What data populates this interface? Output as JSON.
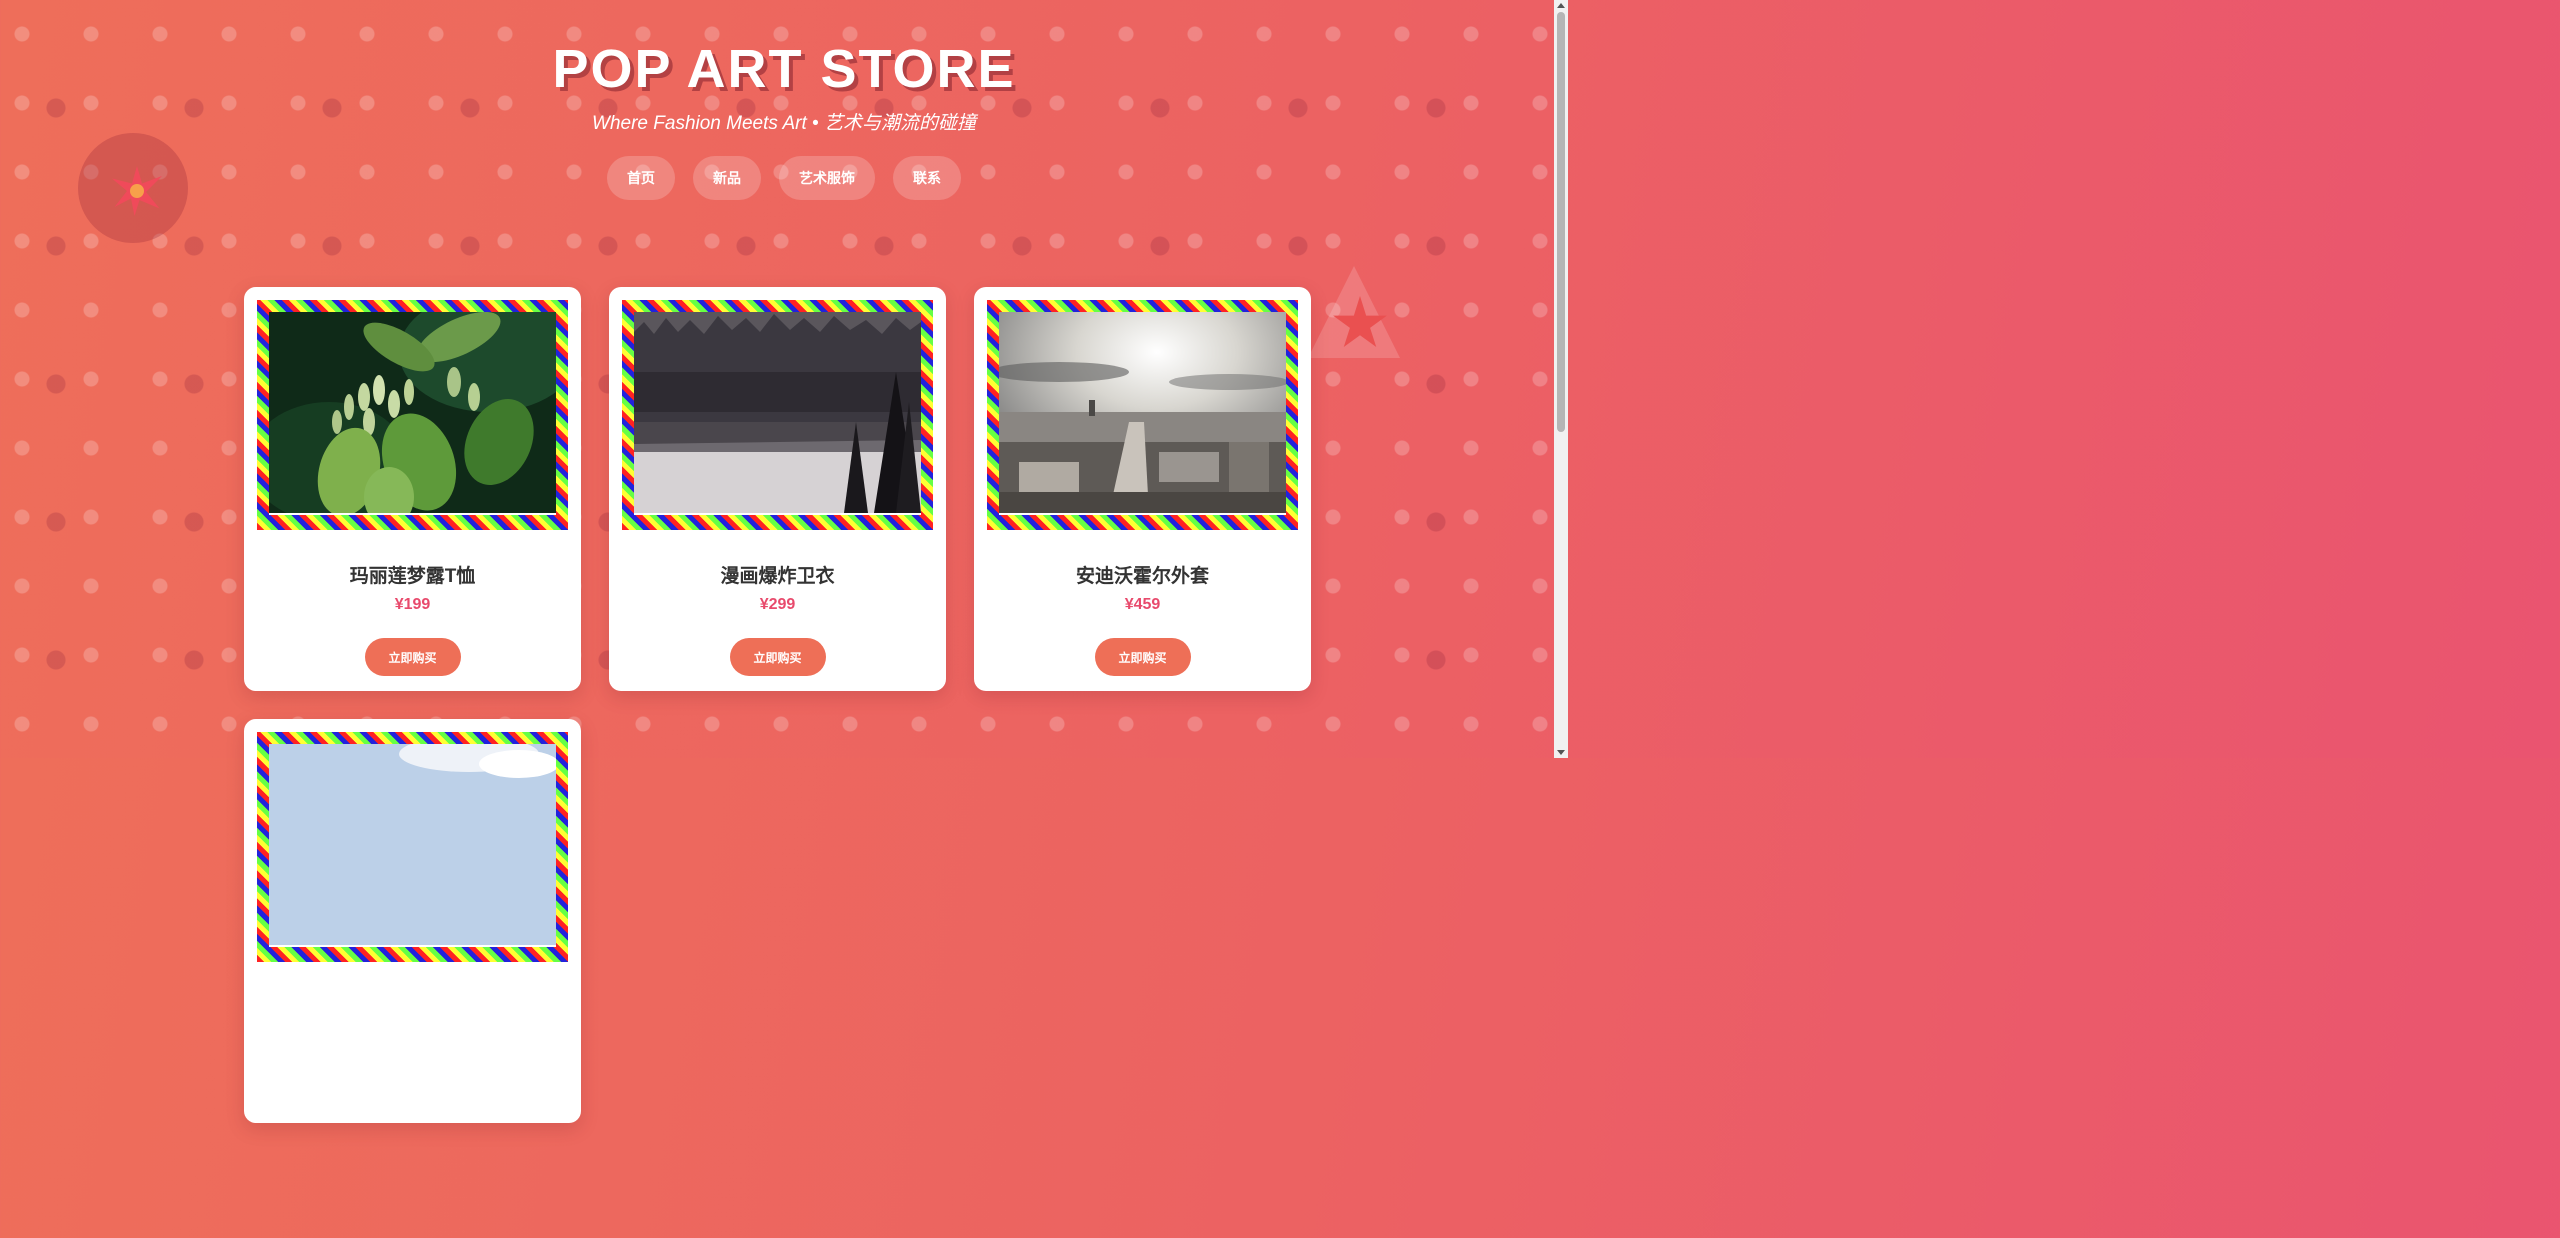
{
  "header": {
    "title": "POP ART STORE",
    "subtitle": "Where Fashion Meets Art • 艺术与潮流的碰撞"
  },
  "nav": {
    "items": [
      {
        "label": "首页"
      },
      {
        "label": "新品"
      },
      {
        "label": "艺术服饰"
      },
      {
        "label": "联系"
      }
    ]
  },
  "products": [
    {
      "name": "玛丽莲梦露T恤",
      "price": "¥199",
      "button": "立即购买",
      "image": "green-leaves-photo"
    },
    {
      "name": "漫画爆炸卫衣",
      "price": "¥299",
      "button": "立即购买",
      "image": "forest-lake-photo"
    },
    {
      "name": "安迪沃霍尔外套",
      "price": "¥459",
      "button": "立即购买",
      "image": "city-skyline-photo"
    },
    {
      "name": "",
      "price": "",
      "button": "",
      "image": "sky-photo"
    }
  ],
  "colors": {
    "accent": "#ee6f57",
    "price": "#e84a6c",
    "background_start": "#ee6e5a",
    "background_end": "#ea5470"
  }
}
